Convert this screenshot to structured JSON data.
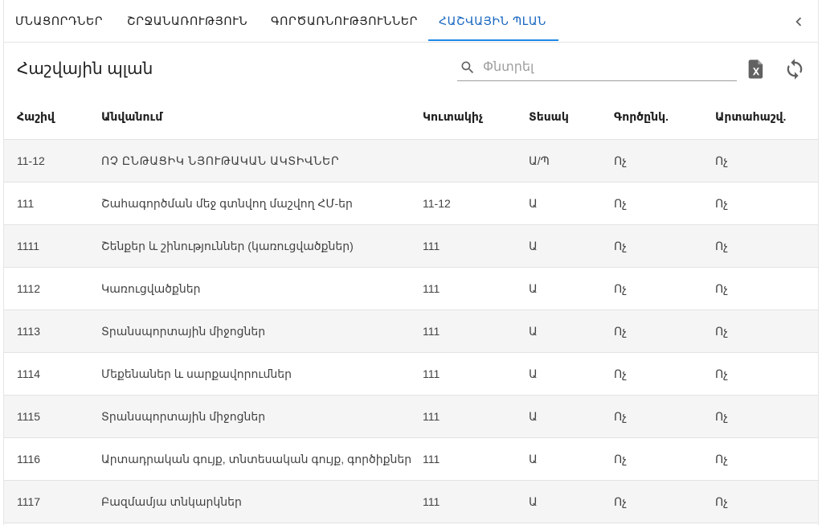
{
  "tabs": [
    {
      "label": "ՄՆԱՑՈՐԴՆԵՐ",
      "active": false
    },
    {
      "label": "ՇՐՋԱՆԱՌՈՒԹՅՈՒՆ",
      "active": false
    },
    {
      "label": "ԳՈՐԾԱՌՆՈՒԹՅՈՒՆՆԵՐ",
      "active": false
    },
    {
      "label": "ՀԱՇՎԱՅԻՆ ՊԼԱՆ",
      "active": true
    }
  ],
  "toolbar": {
    "title": "Հաշվային պլան",
    "search_placeholder": "Փնտրել",
    "search_value": ""
  },
  "icons": {
    "back": "chevron-left-icon",
    "search": "search-icon",
    "excel": "excel-export-icon",
    "refresh": "refresh-icon"
  },
  "colors": {
    "accent": "#1e88e5",
    "active_tab_text": "#1565c0",
    "row_alt": "#f5f5f5"
  },
  "table": {
    "columns": [
      "Հաշիվ",
      "Անվանում",
      "Կուտակիչ",
      "Տեսակ",
      "Գործընկ.",
      "Արտահաշվ."
    ],
    "rows": [
      {
        "account": "11-12",
        "name": "ՈՉ ԸՆԹԱՑԻԿ ՆՅՈՒԹԱԿԱՆ ԱԿՏԻՎՆԵՐ",
        "accumulator": "",
        "type": "Ա/Պ",
        "partner": "Ոչ",
        "offbalance": "Ոչ"
      },
      {
        "account": "111",
        "name": "Շահագործման մեջ գտնվող մաշվող ՀՄ-եր",
        "accumulator": "11-12",
        "type": "Ա",
        "partner": "Ոչ",
        "offbalance": "Ոչ"
      },
      {
        "account": "1111",
        "name": "Շենքեր և շինություններ (կառուցվածքներ)",
        "accumulator": "111",
        "type": "Ա",
        "partner": "Ոչ",
        "offbalance": "Ոչ"
      },
      {
        "account": "1112",
        "name": "Կառուցվածքներ",
        "accumulator": "111",
        "type": "Ա",
        "partner": "Ոչ",
        "offbalance": "Ոչ"
      },
      {
        "account": "1113",
        "name": "Տրանսպորտային միջոցներ",
        "accumulator": "111",
        "type": "Ա",
        "partner": "Ոչ",
        "offbalance": "Ոչ"
      },
      {
        "account": "1114",
        "name": "Մեքենաներ և սարքավորումներ",
        "accumulator": "111",
        "type": "Ա",
        "partner": "Ոչ",
        "offbalance": "Ոչ"
      },
      {
        "account": "1115",
        "name": "Տրանսպորտային միջոցներ",
        "accumulator": "111",
        "type": "Ա",
        "partner": "Ոչ",
        "offbalance": "Ոչ"
      },
      {
        "account": "1116",
        "name": "Արտադրական գույք, տնտեսական գույք, գործիքներ",
        "accumulator": "111",
        "type": "Ա",
        "partner": "Ոչ",
        "offbalance": "Ոչ"
      },
      {
        "account": "1117",
        "name": "Բազմամյա տնկարկներ",
        "accumulator": "111",
        "type": "Ա",
        "partner": "Ոչ",
        "offbalance": "Ոչ"
      }
    ]
  }
}
